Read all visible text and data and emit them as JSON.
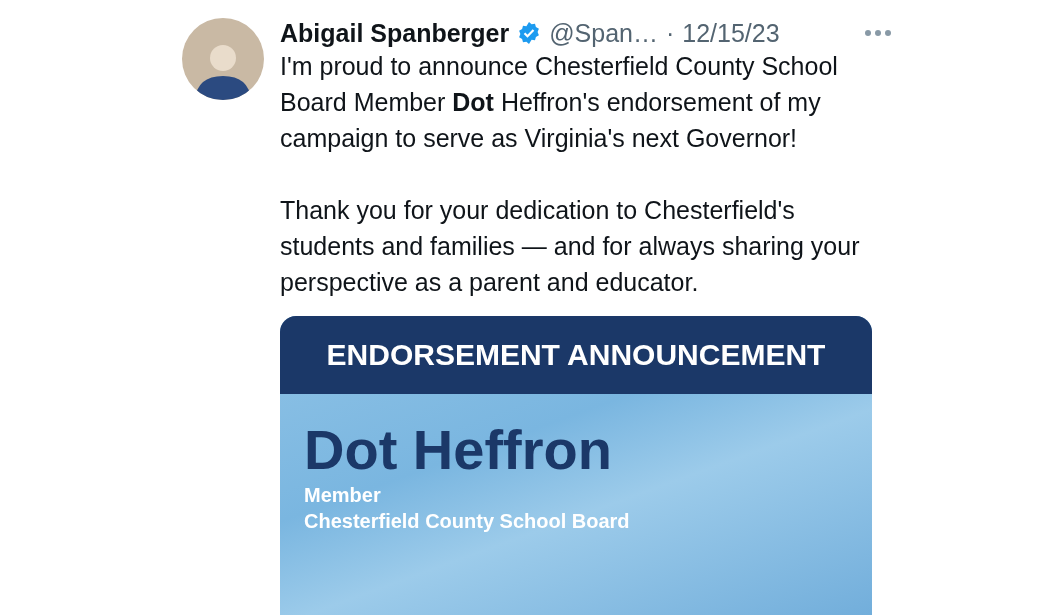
{
  "tweet": {
    "author": {
      "name": "Abigail Spanberger",
      "verified": true,
      "handle": "@Span…",
      "separator": "·",
      "date": "12/15/23"
    },
    "paragraphs": [
      "I'm proud to announce Chesterfield County School Board Member **Dot** Heffron's endorsement of my campaign to serve as Virginia's next Governor!",
      "Thank you for your dedication to Chesterfield's students and families — and for always sharing your perspective as a parent and educator."
    ],
    "media": {
      "banner": "ENDORSEMENT ANNOUNCEMENT",
      "headline": "Dot Heffron",
      "lines": [
        "Member",
        "Chesterfield County School Board"
      ]
    }
  }
}
